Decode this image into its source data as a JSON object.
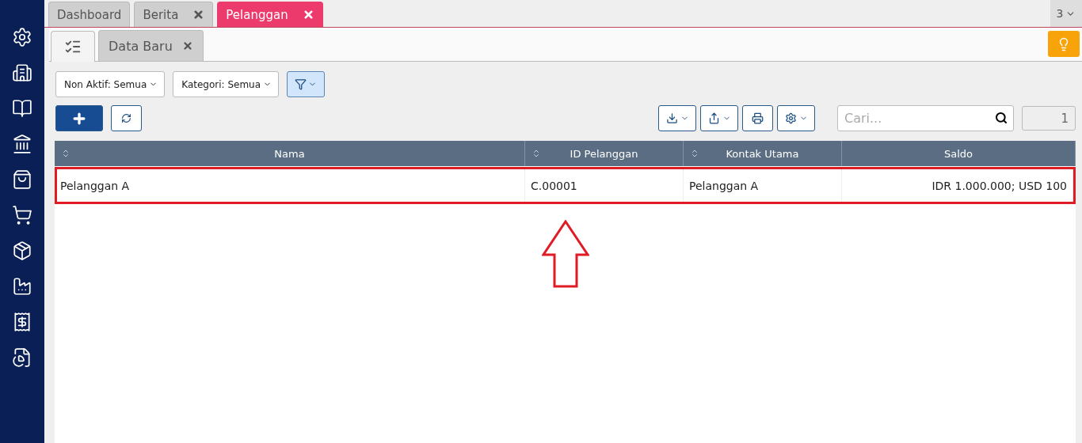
{
  "top_tabs": [
    {
      "label": "Dashboard",
      "selected": false,
      "closable": false
    },
    {
      "label": "Berita",
      "selected": false,
      "closable": true
    },
    {
      "label": "Pelanggan",
      "selected": true,
      "closable": true
    }
  ],
  "tab_count": "3",
  "sub_tabs": [
    {
      "kind": "icon",
      "selected": true
    },
    {
      "kind": "text",
      "label": "Data Baru",
      "selected": false
    }
  ],
  "filters": [
    {
      "label": "Non Aktif: Semua"
    },
    {
      "label": "Kategori: Semua"
    }
  ],
  "search": {
    "placeholder": "Cari..."
  },
  "page": "1",
  "table": {
    "columns": [
      {
        "label": "Nama",
        "sortable": true
      },
      {
        "label": "ID Pelanggan",
        "sortable": true
      },
      {
        "label": "Kontak Utama",
        "sortable": true
      },
      {
        "label": "Saldo",
        "sortable": false
      }
    ],
    "rows": [
      {
        "cells": [
          "Pelanggan A",
          "C.00001",
          "Pelanggan A",
          "IDR 1.000.000; USD 100"
        ],
        "highlighted": true
      }
    ]
  }
}
